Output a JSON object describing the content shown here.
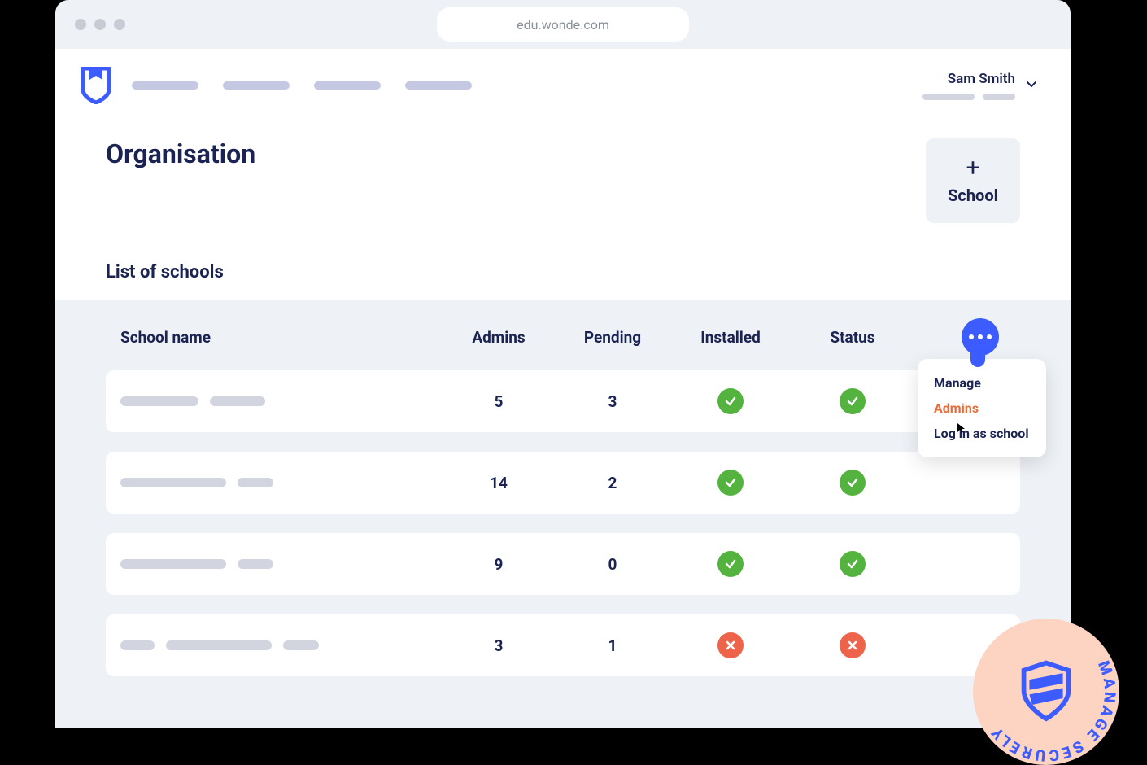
{
  "browser": {
    "url": "edu.wonde.com"
  },
  "user": {
    "name": "Sam Smith"
  },
  "page": {
    "title": "Organisation",
    "subtitle": "List of schools",
    "add_button": {
      "label": "School"
    }
  },
  "table": {
    "headers": {
      "name": "School name",
      "admins": "Admins",
      "pending": "Pending",
      "installed": "Installed",
      "status": "Status"
    },
    "rows": [
      {
        "admins": "5",
        "pending": "3",
        "installed": true,
        "status": true,
        "name_bars": [
          96,
          68
        ]
      },
      {
        "admins": "14",
        "pending": "2",
        "installed": true,
        "status": true,
        "name_bars": [
          130,
          44
        ]
      },
      {
        "admins": "9",
        "pending": "0",
        "installed": true,
        "status": true,
        "name_bars": [
          130,
          44
        ]
      },
      {
        "admins": "3",
        "pending": "1",
        "installed": false,
        "status": false,
        "name_bars": [
          42,
          130,
          44
        ]
      }
    ]
  },
  "popover": {
    "items": [
      {
        "label": "Manage",
        "active": false
      },
      {
        "label": "Admins",
        "active": true
      },
      {
        "label": "Log in as school",
        "active": false
      }
    ]
  },
  "badge": {
    "text": "MANAGE SECURELY"
  }
}
